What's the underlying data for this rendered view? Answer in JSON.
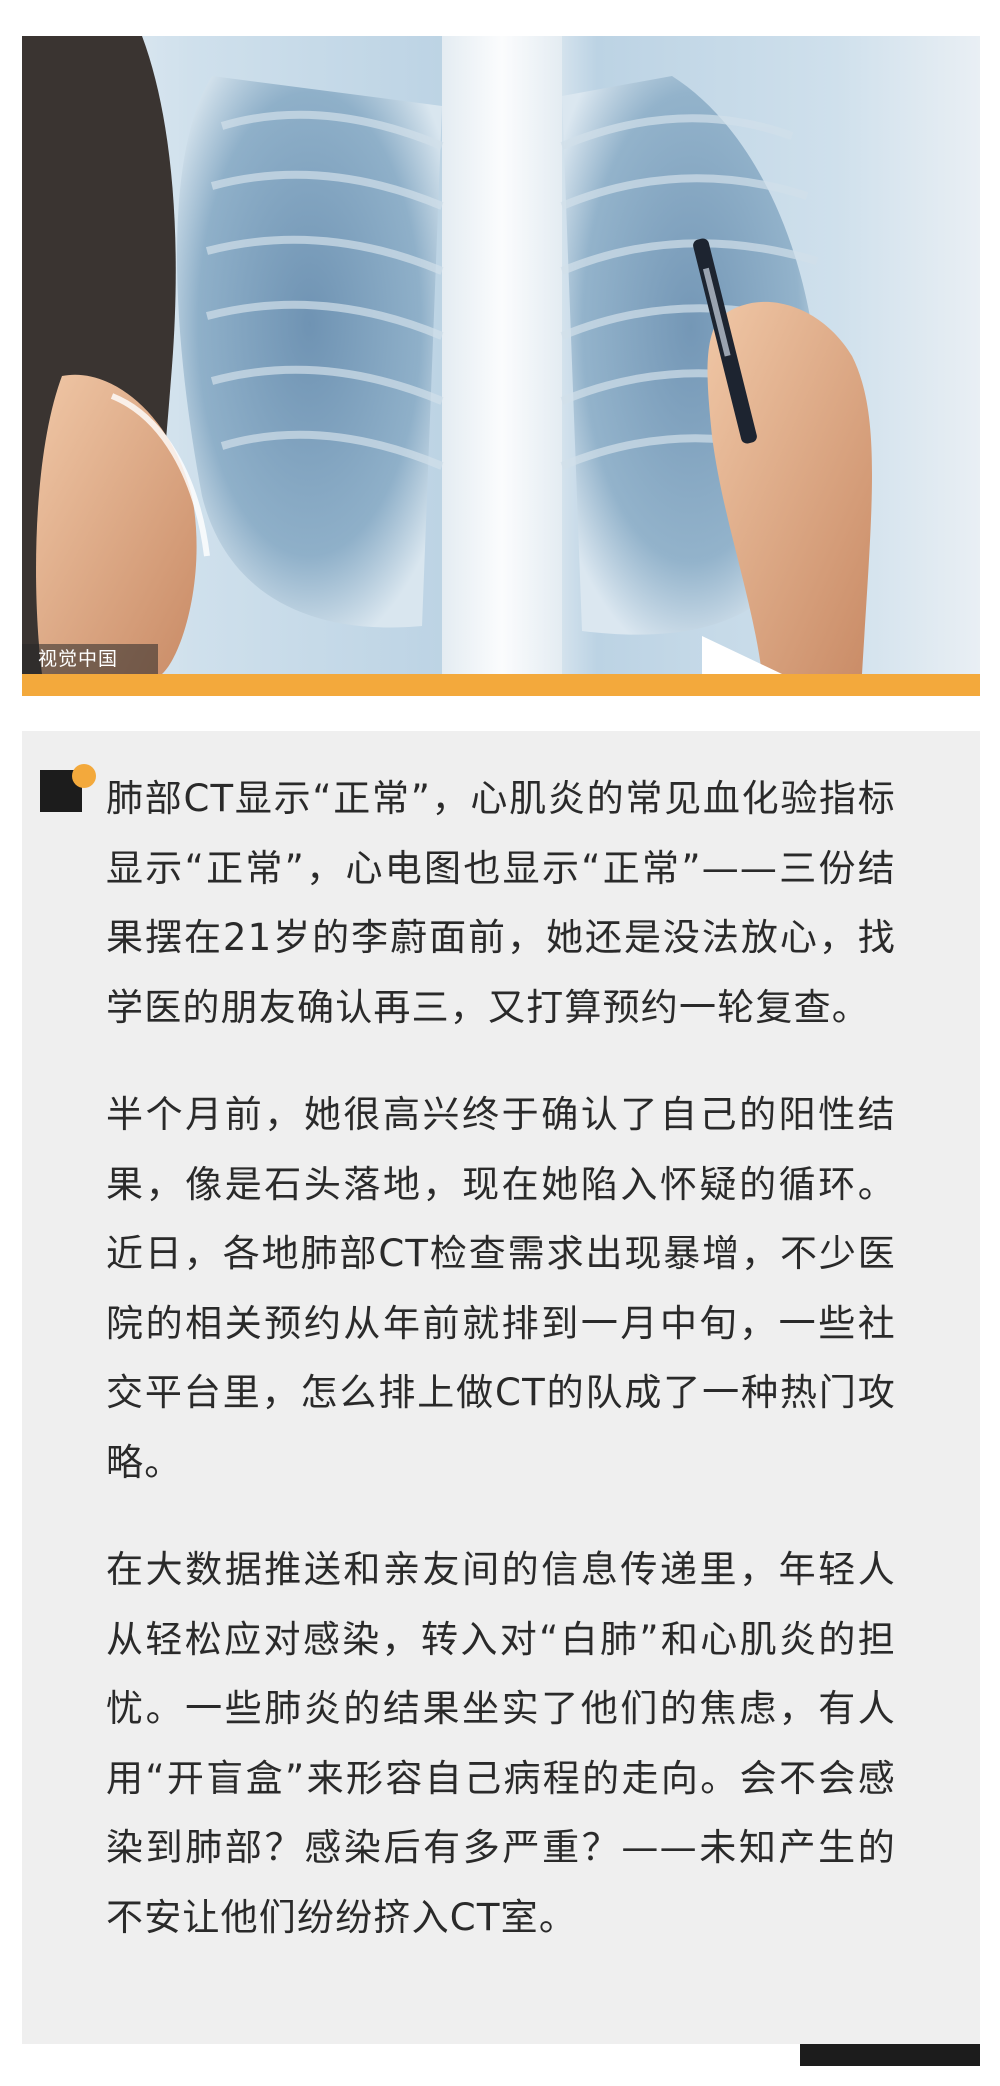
{
  "hero": {
    "image_credit": "视觉中国",
    "accent_color": "#f3a93c"
  },
  "article": {
    "paragraphs": [
      "肺部CT显示“正常”，心肌炎的常见血化验指标显示“正常”，心电图也显示“正常”——三份结果摆在21岁的李蔚面前，她还是没法放心，找学医的朋友确认再三，又打算预约一轮复查。",
      "半个月前，她很高兴终于确认了自己的阳性结果，像是石头落地，现在她陷入怀疑的循环。近日，各地肺部CT检查需求出现暴增，不少医院的相关预约从年前就排到一月中旬，一些社交平台里，怎么排上做CT的队成了一种热门攻略。",
      "在大数据推送和亲友间的信息传递里，年轻人从轻松应对感染，转入对“白肺”和心肌炎的担忧。一些肺炎的结果坐实了他们的焦虑，有人用“开盲盒”来形容自己病程的走向。会不会感染到肺部？感染后有多严重？——未知产生的不安让他们纷纷挤入CT室。"
    ]
  },
  "colors": {
    "card_background": "#efefef",
    "text": "#2a2a2a",
    "dark": "#1c1c1c"
  }
}
